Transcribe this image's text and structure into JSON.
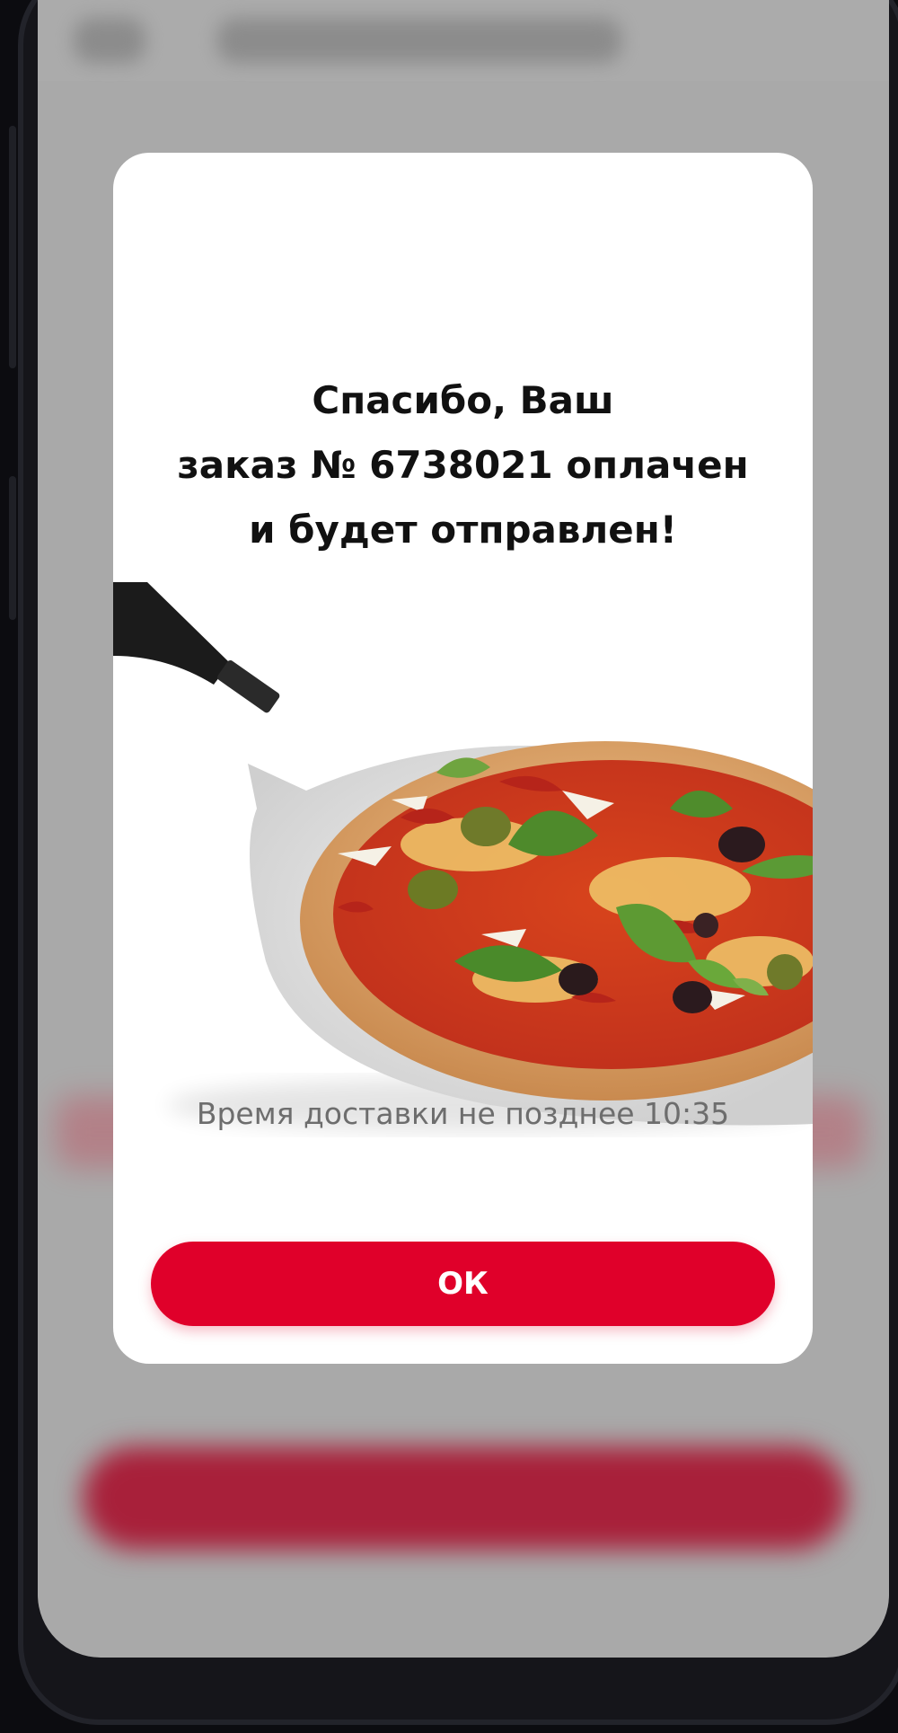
{
  "modal": {
    "title_lines": [
      "Спасибо, Ваш",
      "заказ № 6738021 оплачен",
      "и будет отправлен!"
    ],
    "delivery_text": "Время доставки не позднее 10:35",
    "ok_label": "ОК",
    "image": "pizza-on-peel"
  },
  "colors": {
    "accent": "#e0002a",
    "overlay": "#a9a9a9",
    "modal_bg": "#ffffff"
  }
}
